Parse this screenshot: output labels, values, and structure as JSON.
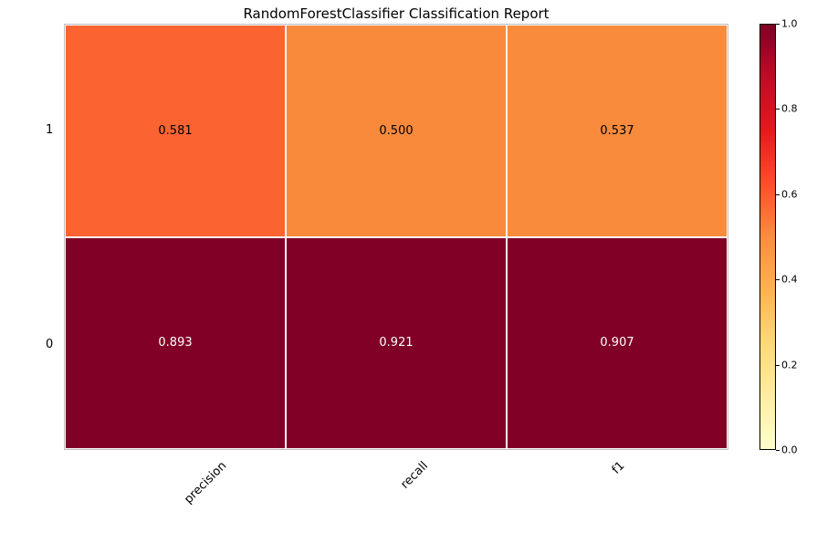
{
  "chart_data": {
    "type": "heatmap",
    "title": "RandomForestClassifier Classification Report",
    "columns": [
      "precision",
      "recall",
      "f1"
    ],
    "rows": [
      "1",
      "0"
    ],
    "values": [
      [
        0.581,
        0.5,
        0.537
      ],
      [
        0.893,
        0.921,
        0.907
      ]
    ],
    "value_labels": [
      [
        "0.581",
        "0.500",
        "0.537"
      ],
      [
        "0.893",
        "0.921",
        "0.907"
      ]
    ],
    "value_label_colors": [
      [
        "#000000",
        "#000000",
        "#000000"
      ],
      [
        "#ffffff",
        "#ffffff",
        "#ffffff"
      ]
    ],
    "cell_colors": [
      [
        "#fb6430",
        "#f98a3c",
        "#f98b3c"
      ],
      [
        "#800026",
        "#800026",
        "#800026"
      ]
    ],
    "colorbar": {
      "min": 0.0,
      "max": 1.0,
      "ticks": [
        "0.0",
        "0.2",
        "0.4",
        "0.6",
        "0.8",
        "1.0"
      ],
      "stops": [
        {
          "p": 0,
          "c": "#800026"
        },
        {
          "p": 12.5,
          "c": "#bc0d26"
        },
        {
          "p": 25,
          "c": "#e31a1c"
        },
        {
          "p": 37.5,
          "c": "#fc4e2a"
        },
        {
          "p": 50,
          "c": "#fd8d3c"
        },
        {
          "p": 62.5,
          "c": "#feb24c"
        },
        {
          "p": 75,
          "c": "#fed976"
        },
        {
          "p": 87.5,
          "c": "#ffeda0"
        },
        {
          "p": 100,
          "c": "#ffffcc"
        }
      ]
    }
  }
}
